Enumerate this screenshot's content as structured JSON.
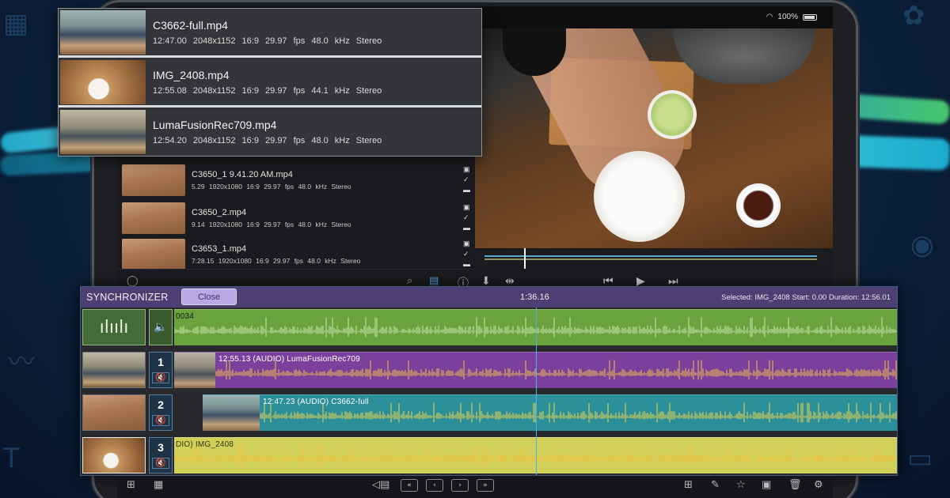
{
  "status": {
    "battery": "100%"
  },
  "clip_popup": [
    {
      "name": "C3662-full.mp4",
      "meta": "12:47.00  2048x1152  16:9  29.97 fps  48.0 kHz  Stereo"
    },
    {
      "name": "IMG_2408.mp4",
      "meta": "12:55.08  2048x1152  16:9  29.97 fps  44.1 kHz  Stereo"
    },
    {
      "name": "LumaFusionRec709.mp4",
      "meta": "12:54.20  2048x1152  16:9  29.97 fps  48.0 kHz  Stereo"
    }
  ],
  "library": [
    {
      "name": "C3650_1 9.41.20 AM.mp4",
      "meta": "5.29  1920x1080  16:9  29.97 fps  48.0 kHz  Stereo"
    },
    {
      "name": "C3650_2.mp4",
      "meta": "9.14  1920x1080  16:9  29.97 fps  48.0 kHz  Stereo"
    },
    {
      "name": "C3653_1.mp4",
      "meta": "7:28.15  1920x1080  16:9  29.97 fps  48.0 kHz  Stereo"
    }
  ],
  "synchronizer": {
    "title": "SYNCHRONIZER",
    "close_label": "Close",
    "time": "1:36.16",
    "selected_info": "Selected: IMG_2408 Start: 0.00 Duration: 12:56.01",
    "master_label": "0034",
    "lanes": [
      {
        "number": "1",
        "label": "12:55.13 (AUDIO)   LumaFusionRec709",
        "color": "#7b3f9c",
        "wave": "#f0c04a"
      },
      {
        "number": "2",
        "label": "12:47.23 (AUDIO)   C3662-full",
        "color": "#2b8f9a",
        "wave": "#f0d64a"
      },
      {
        "number": "3",
        "label": "DIO)   IMG_2408",
        "color": "#cfcf5a",
        "wave": "#f4c13a"
      }
    ],
    "master_color": "#6aa23e"
  },
  "icons": {
    "waveform": "waveform-icon",
    "speaker": "speaker-icon",
    "mute": "mute-icon"
  }
}
